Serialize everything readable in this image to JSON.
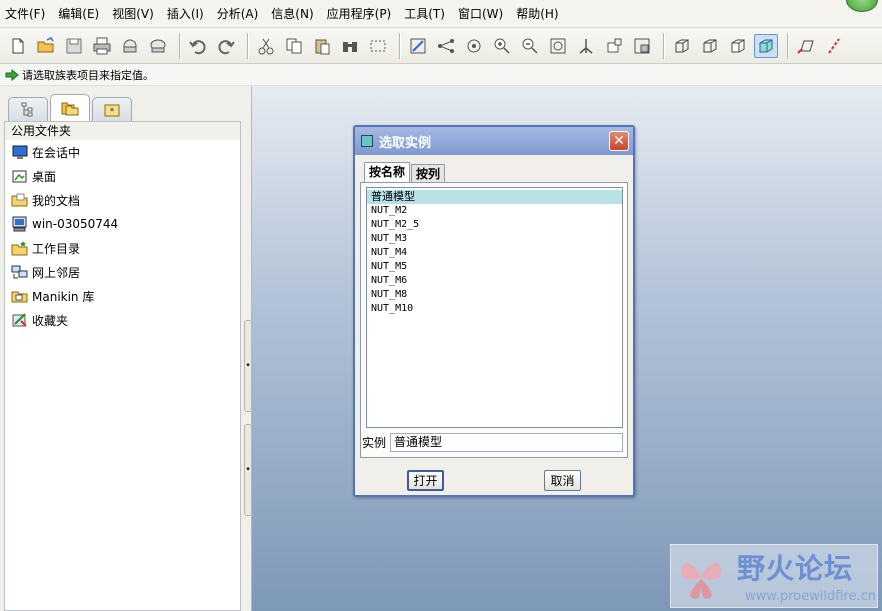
{
  "menubar": {
    "items": [
      "文件(F)",
      "编辑(E)",
      "视图(V)",
      "插入(I)",
      "分析(A)",
      "信息(N)",
      "应用程序(P)",
      "工具(T)",
      "窗口(W)",
      "帮助(H)"
    ]
  },
  "toolbar": {
    "icons": [
      "new-file-icon",
      "open-folder-icon",
      "save-icon",
      "print-icon",
      "send-mail-icon",
      "undo-icon",
      "redo-icon",
      "cut-icon",
      "copy-icon",
      "paste-icon",
      "binoculars-icon",
      "select-box-icon",
      "regenerate-icon",
      "zoom-in-icon",
      "zoom-out-icon",
      "refit-icon",
      "view-orientation-icon",
      "saved-views-icon",
      "layers-icon",
      "wireframe-icon",
      "hidden-line-icon",
      "no-hidden-icon",
      "shading-icon",
      "datum-plane-icon"
    ]
  },
  "message": {
    "text": "请选取族表项目来指定值。"
  },
  "folder_browser": {
    "title": "公用文件夹",
    "items": [
      {
        "label": "在会话中",
        "icon": "monitor-icon"
      },
      {
        "label": "桌面",
        "icon": "desktop-icon"
      },
      {
        "label": "我的文档",
        "icon": "documents-folder-icon"
      },
      {
        "label": "win-03050744",
        "icon": "computer-icon"
      },
      {
        "label": "工作目录",
        "icon": "working-folder-icon"
      },
      {
        "label": "网上邻居",
        "icon": "network-icon"
      },
      {
        "label": "Manikin 库",
        "icon": "library-icon"
      },
      {
        "label": "收藏夹",
        "icon": "favorites-icon"
      }
    ]
  },
  "dialog": {
    "title": "选取实例",
    "tabs": [
      "按名称",
      "按列"
    ],
    "instances": [
      "普通模型",
      "NUT_M2",
      "NUT_M2_5",
      "NUT_M3",
      "NUT_M4",
      "NUT_M5",
      "NUT_M6",
      "NUT_M8",
      "NUT_M10"
    ],
    "selected_instance": "普通模型",
    "instance_label": "实例",
    "instance_value": "普通模型",
    "open_label": "打开",
    "cancel_label": "取消"
  },
  "watermark": {
    "brand": "野火论坛",
    "url": "www.proewildfire.cn"
  }
}
